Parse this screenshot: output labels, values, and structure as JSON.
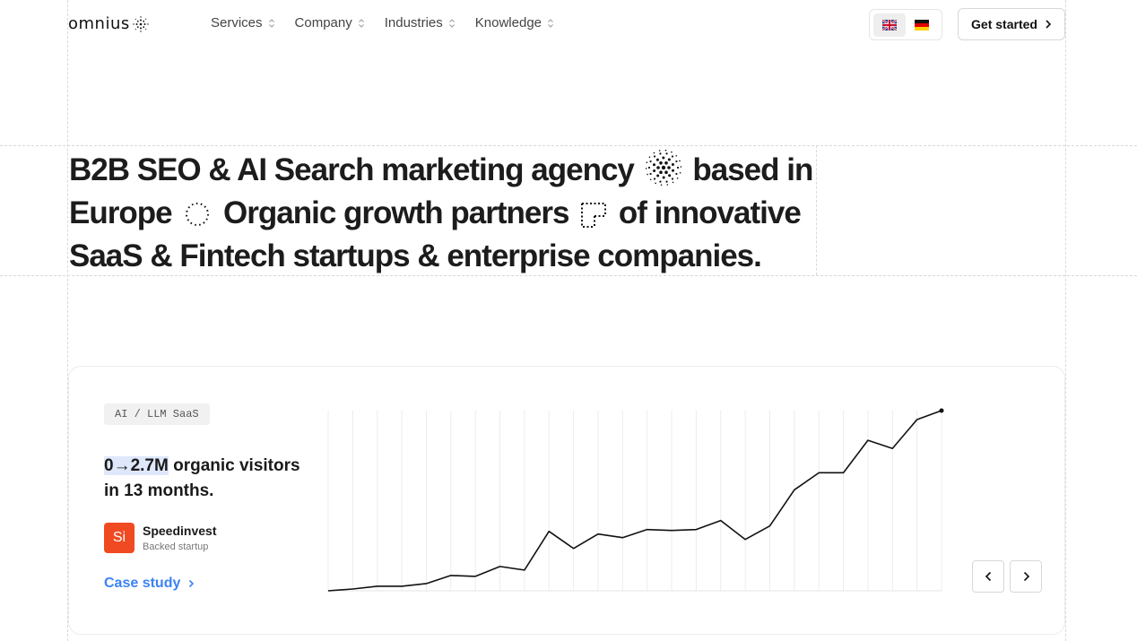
{
  "header": {
    "logo_text": "omnius",
    "nav": [
      {
        "label": "Services"
      },
      {
        "label": "Company"
      },
      {
        "label": "Industries"
      },
      {
        "label": "Knowledge"
      }
    ],
    "languages": [
      {
        "code": "en",
        "icon": "uk-flag-icon",
        "active": true
      },
      {
        "code": "de",
        "icon": "german-flag-icon",
        "active": false
      }
    ],
    "cta_label": "Get started"
  },
  "hero": {
    "part1": "B2B SEO & AI Search marketing agency",
    "part2": "based in Europe",
    "part3": "Organic growth partners",
    "part4": "of innovative SaaS & Fintech startups & enterprise companies."
  },
  "case_card": {
    "tag": "AI / LLM SaaS",
    "stat_highlight": "0→2.7M",
    "stat_rest": " organic visitors in 13 months.",
    "company_initials": "Si",
    "company_name": "Speedinvest",
    "company_sub": "Backed startup",
    "link_label": "Case study",
    "brand_color": "#f04a23",
    "link_color": "#3b82f6"
  },
  "chart_data": {
    "type": "line",
    "values": [
      0,
      0.02,
      0.05,
      0.05,
      0.08,
      0.17,
      0.16,
      0.27,
      0.23,
      0.66,
      0.47,
      0.63,
      0.59,
      0.68,
      0.67,
      0.68,
      0.78,
      0.57,
      0.72,
      1.12,
      1.31,
      1.31,
      1.67,
      1.58,
      1.9,
      2.0
    ],
    "ylim": [
      0,
      2.0
    ],
    "grid": "vertical",
    "line_color": "#111111"
  }
}
